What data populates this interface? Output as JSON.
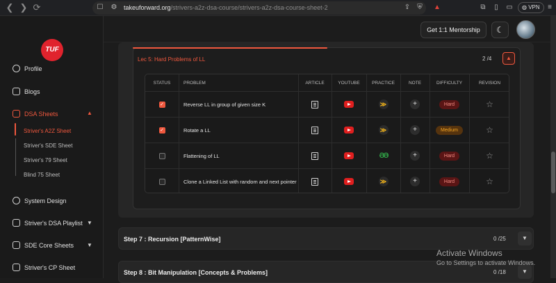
{
  "browser": {
    "url_domain": "takeuforward.org",
    "url_path": "/strivers-a2z-dsa-course/strivers-a2z-dsa-course-sheet-2",
    "vpn_label": "VPN"
  },
  "sidebar": {
    "logo": "TUF",
    "items": [
      {
        "label": "Profile"
      },
      {
        "label": "Blogs"
      },
      {
        "label": "DSA Sheets"
      },
      {
        "label": "System Design"
      },
      {
        "label": "Striver's DSA Playlist"
      },
      {
        "label": "SDE Core Sheets"
      },
      {
        "label": "Striver's CP Sheet"
      }
    ],
    "sub_items": [
      {
        "label": "Striver's A2Z Sheet"
      },
      {
        "label": "Striver's SDE Sheet"
      },
      {
        "label": "Striver's 79 Sheet"
      },
      {
        "label": "Blind 75 Sheet"
      }
    ]
  },
  "topbar": {
    "mentorship_label": "Get 1:1 Mentorship"
  },
  "lecture": {
    "title": "Lec 5: Hard Problems of LL",
    "count": "2 /4",
    "columns": [
      "Status",
      "Problem",
      "Article",
      "YouTube",
      "Practice",
      "Note",
      "Difficulty",
      "Revision"
    ],
    "rows": [
      {
        "checked": true,
        "problem": "Reverse LL in group of given size K",
        "practice": "code360",
        "difficulty": "Hard"
      },
      {
        "checked": true,
        "problem": "Rotate a LL",
        "practice": "code360",
        "difficulty": "Medium"
      },
      {
        "checked": false,
        "problem": "Flattening of LL",
        "practice": "gfg",
        "difficulty": "Hard"
      },
      {
        "checked": false,
        "problem": "Clone a Linked List with random and next pointer",
        "practice": "code360",
        "difficulty": "Hard"
      }
    ]
  },
  "steps": [
    {
      "title": "Step 7 : Recursion [PatternWise]",
      "count": "0 /25"
    },
    {
      "title": "Step 8 : Bit Manipulation [Concepts & Problems]",
      "count": "0 /18"
    }
  ],
  "watermark": {
    "line1": "Activate Windows",
    "line2": "Go to Settings to activate Windows."
  },
  "colors": {
    "accent": "#f0583e",
    "hard": "#f28b82",
    "medium": "#f5a623",
    "youtube": "#e01f1f"
  }
}
